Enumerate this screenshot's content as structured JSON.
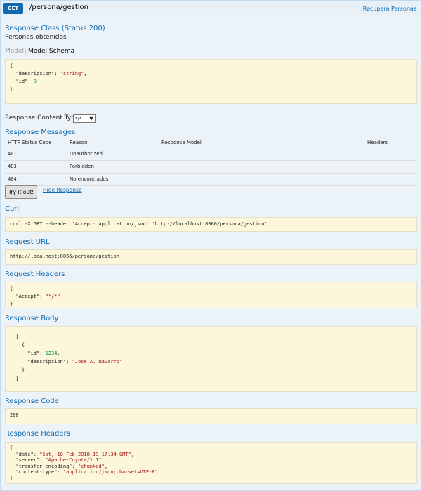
{
  "header": {
    "method": "GET",
    "path": "/persona/gestion",
    "summary": "Recupera Personas"
  },
  "response_class": {
    "title": "Response Class (Status 200)",
    "description": "Personas obtenidos",
    "tabs": [
      "Model",
      "Model Schema"
    ],
    "schema": {
      "key_descripcion": "\"descripcion\"",
      "val_descripcion": "\"string\"",
      "key_id": "\"id\"",
      "val_id": "0"
    }
  },
  "content_type": {
    "label": "Response Content Type",
    "selected": "*/*"
  },
  "messages": {
    "title": "Response Messages",
    "columns": [
      "HTTP Status Code",
      "Reason",
      "Response Model",
      "Headers"
    ],
    "rows": [
      {
        "code": "401",
        "reason": "Unauthorized"
      },
      {
        "code": "403",
        "reason": "Forbidden"
      },
      {
        "code": "404",
        "reason": "No encontrados"
      }
    ]
  },
  "actions": {
    "try_label": "Try it out!",
    "hide_label": "Hide Response"
  },
  "curl": {
    "title": "Curl",
    "command": "curl -X GET --header 'Accept: application/json' 'http://localhost:8066/persona/gestion'"
  },
  "request_url": {
    "title": "Request URL",
    "value": "http://localhost:8066/persona/gestion"
  },
  "request_headers": {
    "title": "Request Headers",
    "key": "\"Accept\"",
    "value": "\"*/*\""
  },
  "response_body": {
    "title": "Response Body",
    "key_id": "\"id\"",
    "val_id": "1234",
    "key_descripcion": "\"descripcion\"",
    "val_descripcion": "\"Jose A. Navarro\""
  },
  "response_code": {
    "title": "Response Code",
    "value": "200"
  },
  "response_headers": {
    "title": "Response Headers",
    "lines": [
      {
        "key": "\"date\"",
        "value": "\"Sat, 10 Feb 2018 19:17:34 GMT\""
      },
      {
        "key": "\"server\"",
        "value": "\"Apache-Coyote/1.1\""
      },
      {
        "key": "\"transfer-encoding\"",
        "value": "\"chunked\""
      },
      {
        "key": "\"content-type\"",
        "value": "\"application/json;charset=UTF-8\""
      }
    ]
  },
  "colors": {
    "accent": "#0f6ab4",
    "code_background": "#fcf6db",
    "panel_background": "#ebf3f9"
  }
}
